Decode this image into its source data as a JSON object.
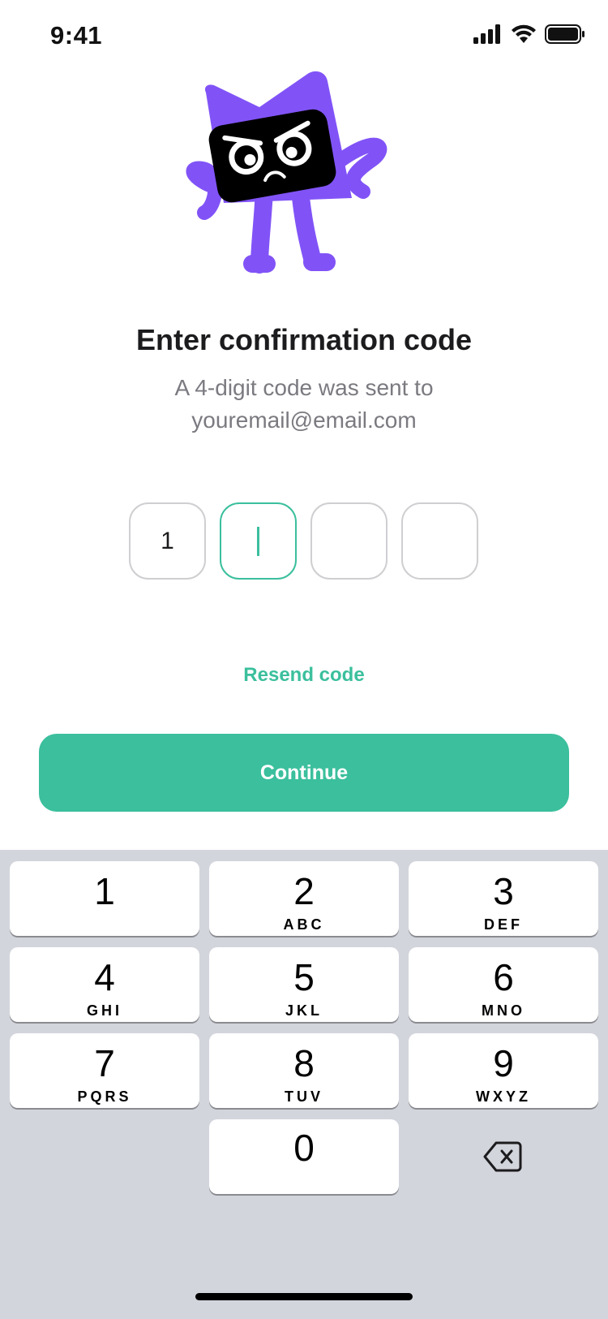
{
  "status": {
    "time": "9:41"
  },
  "heading": {
    "title": "Enter confirmation code",
    "subtitle_line1": "A 4-digit code was sent to",
    "subtitle_line2": "youremail@email.com"
  },
  "code": {
    "digits": [
      "1",
      "",
      "",
      ""
    ],
    "active_index": 1
  },
  "actions": {
    "resend_label": "Resend code",
    "continue_label": "Continue"
  },
  "keyboard": {
    "keys": [
      {
        "digit": "1",
        "letters": ""
      },
      {
        "digit": "2",
        "letters": "ABC"
      },
      {
        "digit": "3",
        "letters": "DEF"
      },
      {
        "digit": "4",
        "letters": "GHI"
      },
      {
        "digit": "5",
        "letters": "JKL"
      },
      {
        "digit": "6",
        "letters": "MNO"
      },
      {
        "digit": "7",
        "letters": "PQRS"
      },
      {
        "digit": "8",
        "letters": "TUV"
      },
      {
        "digit": "9",
        "letters": "WXYZ"
      },
      {
        "digit": "0",
        "letters": ""
      }
    ],
    "delete_icon": "backspace-icon"
  },
  "colors": {
    "accent": "#3bbf9d",
    "mascot": "#8153f7",
    "keyboard_bg": "#d3d5dc"
  }
}
